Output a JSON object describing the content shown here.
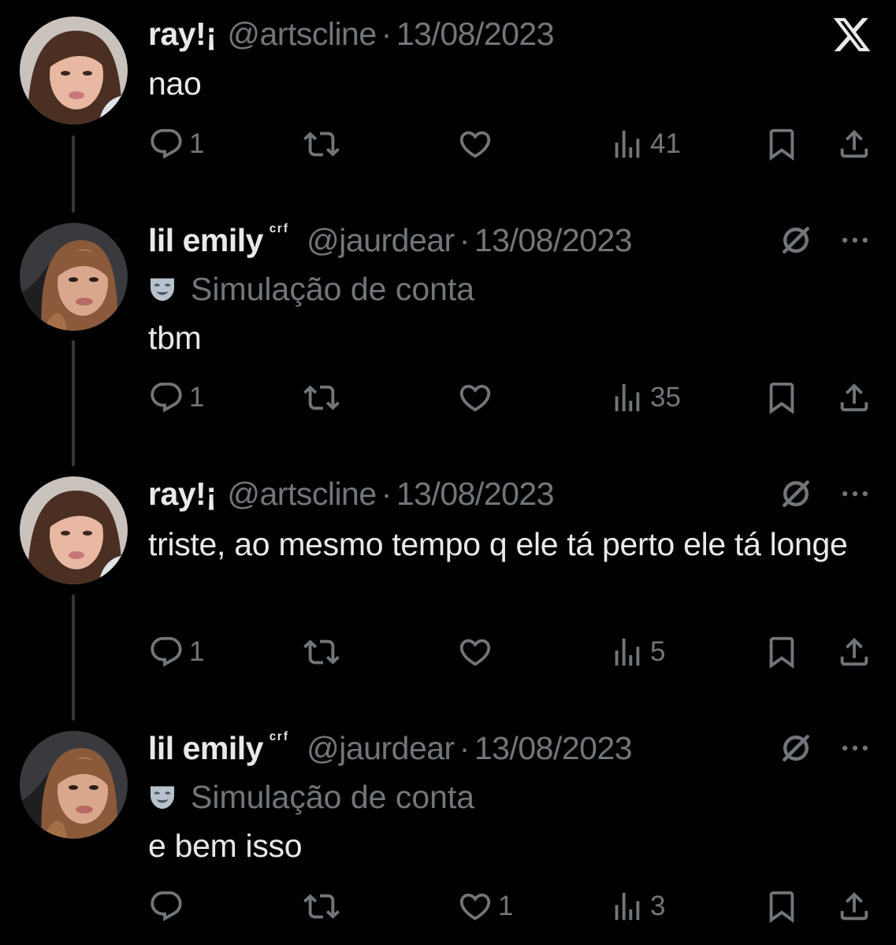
{
  "tweets": [
    {
      "name": "ray!¡",
      "suffix": "",
      "handle": "@artscline",
      "dot": "·",
      "date": "13/08/2023",
      "label": "",
      "text": "nao",
      "actions": {
        "reply": "1",
        "retweet": "",
        "like": "",
        "views": "41"
      }
    },
    {
      "name": "lil emily",
      "suffix": "ᶜʳᶠ",
      "handle": "@jaurdear",
      "dot": "·",
      "date": "13/08/2023",
      "label": "Simulação de conta",
      "text": "tbm",
      "actions": {
        "reply": "1",
        "retweet": "",
        "like": "",
        "views": "35"
      }
    },
    {
      "name": "ray!¡",
      "suffix": "",
      "handle": "@artscline",
      "dot": "·",
      "date": "13/08/2023",
      "label": "",
      "text": "triste, ao mesmo tempo q ele tá perto ele tá longe",
      "actions": {
        "reply": "1",
        "retweet": "",
        "like": "",
        "views": "5"
      }
    },
    {
      "name": "lil emily",
      "suffix": "ᶜʳᶠ",
      "handle": "@jaurdear",
      "dot": "·",
      "date": "13/08/2023",
      "label": "Simulação de conta",
      "text": "e bem isso",
      "actions": {
        "reply": "",
        "retweet": "",
        "like": "1",
        "views": "3"
      }
    }
  ],
  "icons": {
    "brand": "x-logo",
    "mute": "slashed-circle-icon",
    "more": "more-icon",
    "parody": "mask-icon",
    "reply": "reply-icon",
    "retweet": "retweet-icon",
    "like": "heart-icon",
    "views": "views-icon",
    "bookmark": "bookmark-icon",
    "share": "share-icon"
  },
  "colors": {
    "background": "#000000",
    "primary_text": "#e7e9ea",
    "secondary_text": "#71767b",
    "thread_line": "#333639"
  }
}
